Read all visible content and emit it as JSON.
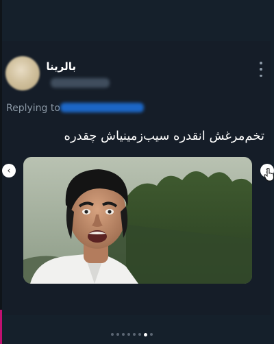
{
  "post": {
    "display_name": "بالرینا",
    "replying_to_label": "Replying to",
    "text": "تخم‌مرغش انقدره سیب‌زمینیاش چقدره"
  },
  "carousel": {
    "prev_glyph": "‹",
    "next_glyph": "›",
    "slide_count": 8,
    "active_index": 6
  },
  "icons": {
    "more": "more-vertical-icon",
    "prev": "chevron-left-icon",
    "next": "chevron-right-icon",
    "cursor": "hand-pointer-icon"
  },
  "colors": {
    "background": "#15202b",
    "text": "#ffffff",
    "muted": "#8b98a5",
    "link": "#1d9bf0",
    "accent_bar": "#c01070"
  }
}
